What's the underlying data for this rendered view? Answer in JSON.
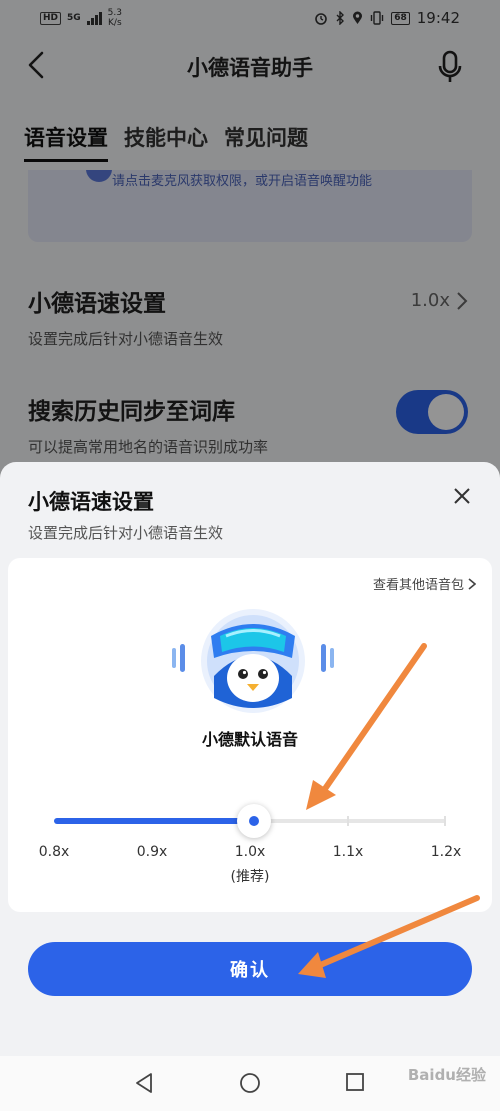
{
  "status_bar": {
    "hd": "HD",
    "network": "5G",
    "speed_value": "5.3",
    "speed_unit": "K/s",
    "battery": "68",
    "time": "19:42"
  },
  "header": {
    "title": "小德语音助手",
    "back_icon": "chevron-left-icon",
    "mic_icon": "microphone-icon"
  },
  "tabs": [
    {
      "label": "语音设置",
      "active": true
    },
    {
      "label": "技能中心",
      "active": false
    },
    {
      "label": "常见问题",
      "active": false
    }
  ],
  "permission_hint": "请点击麦克风获取权限，或开启语音唤醒功能",
  "settings": {
    "speed": {
      "title": "小德语速设置",
      "subtitle": "设置完成后针对小德语音生效",
      "value": "1.0x"
    },
    "sync": {
      "title": "搜索历史同步至词库",
      "subtitle": "可以提高常用地名的语音识别成功率",
      "enabled": true
    }
  },
  "sheet": {
    "title": "小德语速设置",
    "subtitle": "设置完成后针对小德语音生效",
    "other_voices": "查看其他语音包",
    "voice_name": "小德默认语音",
    "speed_options": [
      "0.8x",
      "0.9x",
      "1.0x",
      "1.1x",
      "1.2x"
    ],
    "selected_index": 2,
    "recommend_label": "(推荐)",
    "confirm_label": "确认"
  },
  "nav": {
    "back_icon": "nav-back-icon",
    "home_icon": "nav-home-icon",
    "recent_icon": "nav-recent-icon"
  },
  "watermark": "Baidu经验",
  "colors": {
    "accent": "#2c63e8",
    "annotation": "#f0883e"
  }
}
